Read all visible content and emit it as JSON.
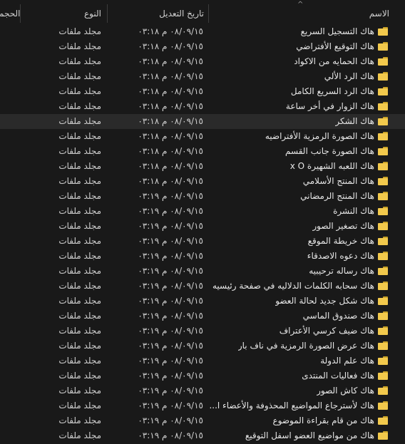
{
  "columns": {
    "name": "الاسم",
    "date": "تاريخ التعديل",
    "type": "النوع",
    "size": "الحجم"
  },
  "folder_type_label": "مجلد ملفات",
  "rows": [
    {
      "name": "هاك التسجيل السريع",
      "date": "٠٨/٠٩/١٥ م ٠٣:١٨"
    },
    {
      "name": "هاك التوقيع الأفتراضي",
      "date": "٠٨/٠٩/١٥ م ٠٣:١٨"
    },
    {
      "name": "هاك الحمايه من الاكواد",
      "date": "٠٨/٠٩/١٥ م ٠٣:١٨"
    },
    {
      "name": "هاك الرد الألي",
      "date": "٠٨/٠٩/١٥ م ٠٣:١٨"
    },
    {
      "name": "هاك الرد السريع الكامل",
      "date": "٠٨/٠٩/١٥ م ٠٣:١٨"
    },
    {
      "name": "هاك الزوار في أخر ساعة",
      "date": "٠٨/٠٩/١٥ م ٠٣:١٨"
    },
    {
      "name": "هاك الشكر",
      "date": "٠٨/٠٩/١٥ م ٠٣:١٨"
    },
    {
      "name": "هاك الصورة الرمزية الأفتراضيه",
      "date": "٠٨/٠٩/١٥ م ٠٣:١٨"
    },
    {
      "name": "هاك الصورة جانب القسم",
      "date": "٠٨/٠٩/١٥ م ٠٣:١٨"
    },
    {
      "name": "هاك اللعبه الشهيرة x O",
      "date": "٠٨/٠٩/١٥ م ٠٣:١٨"
    },
    {
      "name": "هاك المنتج الأسلامي",
      "date": "٠٨/٠٩/١٥ م ٠٣:١٨"
    },
    {
      "name": "هاك المنتج الرمضاني",
      "date": "٠٨/٠٩/١٥ م ٠٣:١٩"
    },
    {
      "name": "هاك النشرة",
      "date": "٠٨/٠٩/١٥ م ٠٣:١٩"
    },
    {
      "name": "هاك تصغير الصور",
      "date": "٠٨/٠٩/١٥ م ٠٣:١٩"
    },
    {
      "name": "هاك خريطة الموقع",
      "date": "٠٨/٠٩/١٥ م ٠٣:١٩"
    },
    {
      "name": "هاك دعوه الاصدقاء",
      "date": "٠٨/٠٩/١٥ م ٠٣:١٩"
    },
    {
      "name": "هاك رساله ترحيبيه",
      "date": "٠٨/٠٩/١٥ م ٠٣:١٩"
    },
    {
      "name": "هاك سحابه الكلمات الدلاليه في صفحة رئيسيه",
      "date": "٠٨/٠٩/١٥ م ٠٣:١٩"
    },
    {
      "name": "هاك شكل جديد لحالة العضو",
      "date": "٠٨/٠٩/١٥ م ٠٣:١٩"
    },
    {
      "name": "هاك صندوق الماسي",
      "date": "٠٨/٠٩/١٥ م ٠٣:١٩"
    },
    {
      "name": "هاك ضيف كرسي الأعتراف",
      "date": "٠٨/٠٩/١٥ م ٠٣:١٩"
    },
    {
      "name": "هاك عرض الصورة الرمزية في ناف بار",
      "date": "٠٨/٠٩/١٥ م ٠٣:١٩"
    },
    {
      "name": "هاك علم الدولة",
      "date": "٠٨/٠٩/١٥ م ٠٣:١٩"
    },
    {
      "name": "هاك فعاليات المنتدى",
      "date": "٠٨/٠٩/١٥ م ٠٣:١٩"
    },
    {
      "name": "هاك كاش الصور",
      "date": "٠٨/٠٩/١٥ م ٠٣:١٩"
    },
    {
      "name": "هاك لأسترجاع المواضيع المحذوفة والأعضاء ا...",
      "date": "٠٨/٠٩/١٥ م ٠٣:١٩"
    },
    {
      "name": "هاك من قام بقراءة الموضوع",
      "date": "٠٨/٠٩/١٥ م ٠٣:١٩"
    },
    {
      "name": "هاك من مواضيع العضو اسفل التوقيع",
      "date": "٠٨/٠٩/١٥ م ٠٣:١٩"
    }
  ],
  "hovered_row_index": 6,
  "colors": {
    "background": "#191919",
    "hover_row": "#2a2a2a",
    "folder": "#f2c94c",
    "text": "#e6e6e6"
  },
  "icons": {
    "folder": "folder-icon",
    "sort": "sort-ascending-icon"
  }
}
